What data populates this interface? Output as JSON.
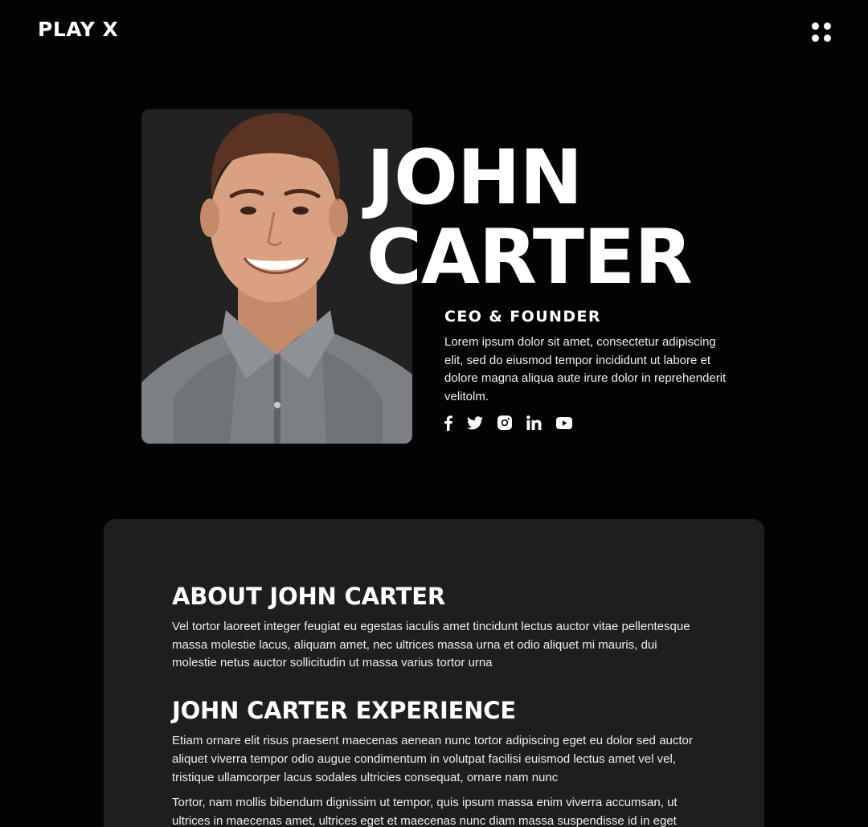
{
  "header": {
    "logo": "PLAY X",
    "menu_icon": "grid-dots-icon"
  },
  "hero": {
    "name_line1": "JOHN",
    "name_line2": "CARTER",
    "role": "CEO & FOUNDER",
    "description": "Lorem ipsum dolor sit amet, consectetur adipiscing elit, sed do eiusmod tempor incididunt ut labore et dolore magna aliqua aute irure dolor in reprehenderit velitolm.",
    "socials": [
      "facebook-icon",
      "twitter-icon",
      "instagram-icon",
      "linkedin-icon",
      "youtube-icon"
    ]
  },
  "about": {
    "title": "ABOUT JOHN CARTER",
    "text": "Vel tortor laoreet integer feugiat eu egestas iaculis amet tincidunt lectus auctor vitae pellentesque massa molestie lacus, aliquam amet, nec ultrices massa urna et odio aliquet mi mauris, dui molestie netus auctor sollicitudin ut massa varius tortor urna"
  },
  "experience": {
    "title": "JOHN CARTER EXPERIENCE",
    "text1": "Etiam ornare elit risus praesent maecenas aenean nunc tortor adipiscing eget eu dolor sed auctor aliquet viverra tempor odio augue condimentum in volutpat facilisi euismod lectus amet vel vel, tristique ullamcorper lacus sodales ultricies consequat, ornare nam nunc",
    "text2": "Tortor, nam mollis bibendum dignissim ut tempor, quis ipsum massa enim viverra accumsan, ut ultrices in maecenas amet, ultrices eget et maecenas nunc diam massa suspendisse id in eget blandit ac"
  },
  "colors": {
    "background": "#030303",
    "card": "#1e1e1e",
    "portrait_bg": "#222222",
    "text": "#ffffff"
  }
}
